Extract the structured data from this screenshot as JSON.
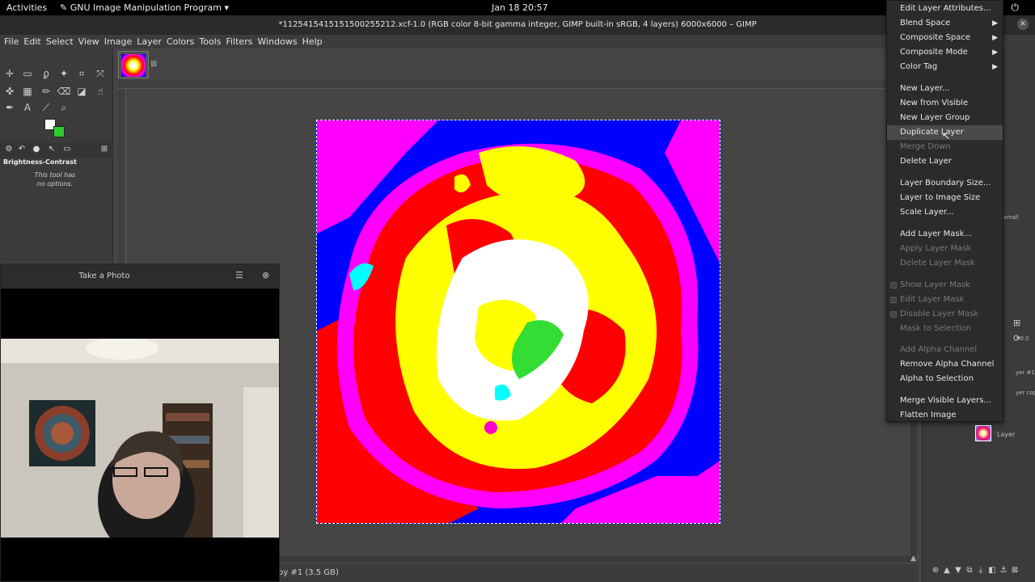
{
  "topbar": {
    "activities": "Activities",
    "app_name": "GNU Image Manipulation Program",
    "clock": "Jan 18  20:57"
  },
  "window": {
    "title": "*1125415415151500255212.xcf-1.0 (RGB color 8-bit gamma integer, GIMP built-in sRGB, 4 layers) 6000x6000 – GIMP"
  },
  "menubar": {
    "items": [
      "File",
      "Edit",
      "Select",
      "View",
      "Image",
      "Layer",
      "Colors",
      "Tools",
      "Filters",
      "Windows",
      "Help"
    ]
  },
  "tool_options": {
    "title": "Brightness-Contrast",
    "message_line1": "This tool has",
    "message_line2": "no options."
  },
  "status": {
    "text": "py #1 (3.5 GB)"
  },
  "webcam": {
    "title": "Take a Photo"
  },
  "context_menu": {
    "items": [
      {
        "label": "Edit Layer Attributes...",
        "enabled": true
      },
      {
        "label": "Blend Space",
        "enabled": true,
        "submenu": true
      },
      {
        "label": "Composite Space",
        "enabled": true,
        "submenu": true
      },
      {
        "label": "Composite Mode",
        "enabled": true,
        "submenu": true
      },
      {
        "label": "Color Tag",
        "enabled": true,
        "submenu": true
      },
      {
        "label": "New Layer...",
        "enabled": true
      },
      {
        "label": "New from Visible",
        "enabled": true
      },
      {
        "label": "New Layer Group",
        "enabled": true
      },
      {
        "label": "Duplicate Layer",
        "enabled": true,
        "highlighted": true
      },
      {
        "label": "Merge Down",
        "enabled": false
      },
      {
        "label": "Delete Layer",
        "enabled": true
      },
      {
        "label": "Layer Boundary Size...",
        "enabled": true
      },
      {
        "label": "Layer to Image Size",
        "enabled": true
      },
      {
        "label": "Scale Layer...",
        "enabled": true
      },
      {
        "label": "Add Layer Mask...",
        "enabled": true
      },
      {
        "label": "Apply Layer Mask",
        "enabled": false
      },
      {
        "label": "Delete Layer Mask",
        "enabled": false
      },
      {
        "label": "Show Layer Mask",
        "enabled": false,
        "checkbox": true
      },
      {
        "label": "Edit Layer Mask",
        "enabled": false,
        "checkbox": true
      },
      {
        "label": "Disable Layer Mask",
        "enabled": false,
        "checkbox": true
      },
      {
        "label": "Mask to Selection",
        "enabled": false
      },
      {
        "label": "Add Alpha Channel",
        "enabled": false
      },
      {
        "label": "Remove Alpha Channel",
        "enabled": true
      },
      {
        "label": "Alpha to Selection",
        "enabled": true
      },
      {
        "label": "Merge Visible Layers...",
        "enabled": true
      },
      {
        "label": "Flatten Image",
        "enabled": true
      }
    ]
  },
  "dock": {
    "layer_name": "Layer",
    "layer_copy_name": "yer copy",
    "layer_hash": "yer #1",
    "small_label": "small",
    "zoom_value": "00.0"
  }
}
